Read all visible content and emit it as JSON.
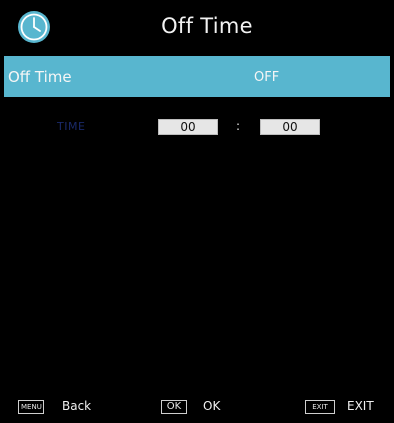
{
  "header": {
    "title": "Off Time",
    "icon": "clock-icon",
    "accent": "#58b6cf"
  },
  "setting": {
    "label": "Off Time",
    "value": "OFF",
    "highlight_color": "#58b6cf"
  },
  "time": {
    "label": "TIME",
    "hour": "00",
    "separator": ":",
    "minute": "00"
  },
  "footer": {
    "back_key": "MENU",
    "back_label": "Back",
    "ok_key": "OK",
    "ok_label": "OK",
    "exit_key": "EXIT",
    "exit_label": "EXIT"
  }
}
